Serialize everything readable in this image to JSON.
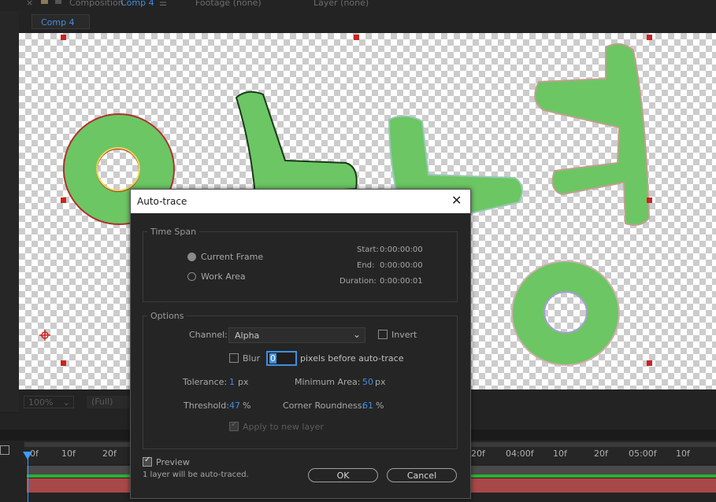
{
  "top_tabs": {
    "close_glyph": "×",
    "composition_label": "Composition",
    "composition_name": "Comp 4",
    "menu_glyph": "☰",
    "footage_label": "Footage (none)",
    "layer_label": "Layer (none)"
  },
  "comp_tab": {
    "label": "Comp 4"
  },
  "viewer": {
    "zoom": "100%",
    "resolution": "(Full)"
  },
  "timeline": {
    "ruler_labels": [
      "0f",
      "10f",
      "20f",
      "20f",
      "04:00f",
      "10f",
      "20f",
      "05:00f",
      "10f"
    ]
  },
  "dialog": {
    "title": "Auto-trace",
    "close_glyph": "✕",
    "time_span": {
      "label": "Time Span",
      "current_frame": "Current Frame",
      "work_area": "Work Area",
      "start_label": "Start:",
      "start_value": "0:00:00:00",
      "end_label": "End:",
      "end_value": "0:00:00:00",
      "duration_label": "Duration:",
      "duration_value": "0:00:00:01"
    },
    "options": {
      "label": "Options",
      "channel_label": "Channel:",
      "channel_value": "Alpha",
      "invert_label": "Invert",
      "blur_label": "Blur",
      "blur_value": "0",
      "blur_suffix": "pixels before auto-trace",
      "tolerance_label": "Tolerance:",
      "tolerance_value": "1",
      "tolerance_unit": "px",
      "min_area_label": "Minimum Area:",
      "min_area_value": "50",
      "min_area_unit": "px",
      "threshold_label": "Threshold:",
      "threshold_value": "47",
      "threshold_unit": "%",
      "corner_label": "Corner Roundness:",
      "corner_value": "61",
      "corner_unit": "%",
      "apply_new_layer_label": "Apply to new layer"
    },
    "preview_label": "Preview",
    "status_text": "1 layer will be auto-traced.",
    "ok_label": "OK",
    "cancel_label": "Cancel"
  },
  "colors": {
    "accent": "#3f8fe0",
    "shape_fill": "#6cc663",
    "handle": "#cc2222"
  },
  "icons": [
    "close-icon",
    "lock-icon",
    "menu-icon",
    "anchor-point-icon",
    "playhead-icon",
    "dropdown-arrow-icon",
    "checkmark-icon"
  ]
}
